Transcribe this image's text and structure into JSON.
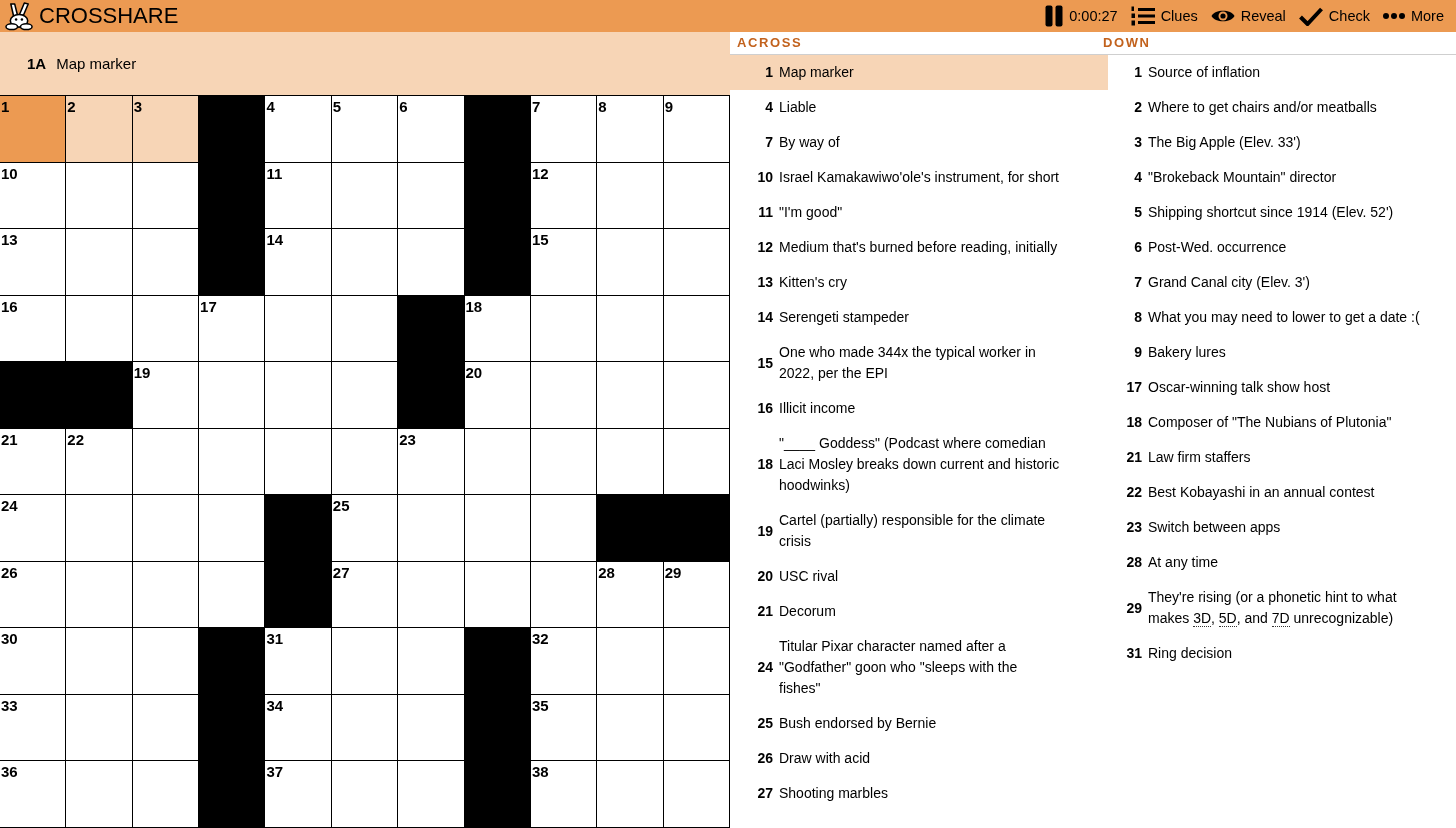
{
  "app": {
    "name": "CROSSHARE"
  },
  "toolbar": [
    {
      "kind": "timer",
      "label": "0:00:27"
    },
    {
      "kind": "clues",
      "label": "Clues"
    },
    {
      "kind": "reveal",
      "label": "Reveal"
    },
    {
      "kind": "check",
      "label": "Check"
    },
    {
      "kind": "more",
      "label": "More"
    }
  ],
  "current_clue": {
    "label": "1A",
    "text": "Map marker"
  },
  "grid": {
    "rows": [
      [
        {
          "kind": "open",
          "number": "1",
          "selected": true
        },
        {
          "kind": "open",
          "number": "2",
          "selected": false,
          "in_word": true
        },
        {
          "kind": "open",
          "number": "3",
          "selected": false,
          "in_word": true
        },
        {
          "kind": "block"
        },
        {
          "kind": "open",
          "number": "4",
          "selected": false,
          "in_word": false
        },
        {
          "kind": "open",
          "number": "5",
          "selected": false,
          "in_word": false
        },
        {
          "kind": "open",
          "number": "6",
          "selected": false,
          "in_word": false
        },
        {
          "kind": "block"
        },
        {
          "kind": "open",
          "number": "7",
          "selected": false,
          "in_word": false
        },
        {
          "kind": "open",
          "number": "8",
          "selected": false,
          "in_word": false
        },
        {
          "kind": "open",
          "number": "9",
          "selected": false,
          "in_word": false
        }
      ],
      [
        {
          "kind": "open",
          "number": "10",
          "selected": false,
          "in_word": false
        },
        {
          "kind": "open",
          "selected": false,
          "in_word": false
        },
        {
          "kind": "open",
          "selected": false,
          "in_word": false
        },
        {
          "kind": "block"
        },
        {
          "kind": "open",
          "number": "11",
          "selected": false,
          "in_word": false
        },
        {
          "kind": "open",
          "selected": false,
          "in_word": false
        },
        {
          "kind": "open",
          "selected": false,
          "in_word": false
        },
        {
          "kind": "block"
        },
        {
          "kind": "open",
          "number": "12",
          "selected": false,
          "in_word": false
        },
        {
          "kind": "open",
          "selected": false,
          "in_word": false
        },
        {
          "kind": "open",
          "selected": false,
          "in_word": false
        }
      ],
      [
        {
          "kind": "open",
          "number": "13",
          "selected": false,
          "in_word": false
        },
        {
          "kind": "open",
          "selected": false,
          "in_word": false
        },
        {
          "kind": "open",
          "selected": false,
          "in_word": false
        },
        {
          "kind": "block"
        },
        {
          "kind": "open",
          "number": "14",
          "selected": false,
          "in_word": false
        },
        {
          "kind": "open",
          "selected": false,
          "in_word": false
        },
        {
          "kind": "open",
          "selected": false,
          "in_word": false
        },
        {
          "kind": "block"
        },
        {
          "kind": "open",
          "number": "15",
          "selected": false,
          "in_word": false
        },
        {
          "kind": "open",
          "selected": false,
          "in_word": false
        },
        {
          "kind": "open",
          "selected": false,
          "in_word": false
        }
      ],
      [
        {
          "kind": "open",
          "number": "16",
          "selected": false,
          "in_word": false
        },
        {
          "kind": "open",
          "selected": false,
          "in_word": false
        },
        {
          "kind": "open",
          "selected": false,
          "in_word": false
        },
        {
          "kind": "open",
          "number": "17",
          "selected": false,
          "in_word": false
        },
        {
          "kind": "open",
          "selected": false,
          "in_word": false
        },
        {
          "kind": "open",
          "selected": false,
          "in_word": false
        },
        {
          "kind": "block"
        },
        {
          "kind": "open",
          "number": "18",
          "selected": false,
          "in_word": false
        },
        {
          "kind": "open",
          "selected": false,
          "in_word": false
        },
        {
          "kind": "open",
          "selected": false,
          "in_word": false
        },
        {
          "kind": "open",
          "selected": false,
          "in_word": false
        }
      ],
      [
        {
          "kind": "block"
        },
        {
          "kind": "block"
        },
        {
          "kind": "open",
          "number": "19",
          "selected": false,
          "in_word": false
        },
        {
          "kind": "open",
          "selected": false,
          "in_word": false
        },
        {
          "kind": "open",
          "selected": false,
          "in_word": false
        },
        {
          "kind": "open",
          "selected": false,
          "in_word": false
        },
        {
          "kind": "block"
        },
        {
          "kind": "open",
          "number": "20",
          "selected": false,
          "in_word": false
        },
        {
          "kind": "open",
          "selected": false,
          "in_word": false
        },
        {
          "kind": "open",
          "selected": false,
          "in_word": false
        },
        {
          "kind": "open",
          "selected": false,
          "in_word": false
        }
      ],
      [
        {
          "kind": "open",
          "number": "21",
          "selected": false,
          "in_word": false
        },
        {
          "kind": "open",
          "number": "22",
          "selected": false,
          "in_word": false
        },
        {
          "kind": "open",
          "selected": false,
          "in_word": false
        },
        {
          "kind": "open",
          "selected": false,
          "in_word": false
        },
        {
          "kind": "open",
          "selected": false,
          "in_word": false
        },
        {
          "kind": "open",
          "selected": false,
          "in_word": false
        },
        {
          "kind": "open",
          "number": "23",
          "selected": false,
          "in_word": false
        },
        {
          "kind": "open",
          "selected": false,
          "in_word": false
        },
        {
          "kind": "open",
          "selected": false,
          "in_word": false
        },
        {
          "kind": "open",
          "selected": false,
          "in_word": false
        },
        {
          "kind": "open",
          "selected": false,
          "in_word": false
        }
      ],
      [
        {
          "kind": "open",
          "number": "24",
          "selected": false,
          "in_word": false
        },
        {
          "kind": "open",
          "selected": false,
          "in_word": false
        },
        {
          "kind": "open",
          "selected": false,
          "in_word": false
        },
        {
          "kind": "open",
          "selected": false,
          "in_word": false
        },
        {
          "kind": "block"
        },
        {
          "kind": "open",
          "number": "25",
          "selected": false,
          "in_word": false
        },
        {
          "kind": "open",
          "selected": false,
          "in_word": false
        },
        {
          "kind": "open",
          "selected": false,
          "in_word": false
        },
        {
          "kind": "open",
          "selected": false,
          "in_word": false
        },
        {
          "kind": "block"
        },
        {
          "kind": "block"
        }
      ],
      [
        {
          "kind": "open",
          "number": "26",
          "selected": false,
          "in_word": false
        },
        {
          "kind": "open",
          "selected": false,
          "in_word": false
        },
        {
          "kind": "open",
          "selected": false,
          "in_word": false
        },
        {
          "kind": "open",
          "selected": false,
          "in_word": false
        },
        {
          "kind": "block"
        },
        {
          "kind": "open",
          "number": "27",
          "selected": false,
          "in_word": false
        },
        {
          "kind": "open",
          "selected": false,
          "in_word": false
        },
        {
          "kind": "open",
          "selected": false,
          "in_word": false
        },
        {
          "kind": "open",
          "selected": false,
          "in_word": false
        },
        {
          "kind": "open",
          "number": "28",
          "selected": false,
          "in_word": false
        },
        {
          "kind": "open",
          "number": "29",
          "selected": false,
          "in_word": false
        }
      ],
      [
        {
          "kind": "open",
          "number": "30",
          "selected": false,
          "in_word": false
        },
        {
          "kind": "open",
          "selected": false,
          "in_word": false
        },
        {
          "kind": "open",
          "selected": false,
          "in_word": false
        },
        {
          "kind": "block"
        },
        {
          "kind": "open",
          "number": "31",
          "selected": false,
          "in_word": false
        },
        {
          "kind": "open",
          "selected": false,
          "in_word": false
        },
        {
          "kind": "open",
          "selected": false,
          "in_word": false
        },
        {
          "kind": "block"
        },
        {
          "kind": "open",
          "number": "32",
          "selected": false,
          "in_word": false
        },
        {
          "kind": "open",
          "selected": false,
          "in_word": false
        },
        {
          "kind": "open",
          "selected": false,
          "in_word": false
        }
      ],
      [
        {
          "kind": "open",
          "number": "33",
          "selected": false,
          "in_word": false
        },
        {
          "kind": "open",
          "selected": false,
          "in_word": false
        },
        {
          "kind": "open",
          "selected": false,
          "in_word": false
        },
        {
          "kind": "block"
        },
        {
          "kind": "open",
          "number": "34",
          "selected": false,
          "in_word": false
        },
        {
          "kind": "open",
          "selected": false,
          "in_word": false
        },
        {
          "kind": "open",
          "selected": false,
          "in_word": false
        },
        {
          "kind": "block"
        },
        {
          "kind": "open",
          "number": "35",
          "selected": false,
          "in_word": false
        },
        {
          "kind": "open",
          "selected": false,
          "in_word": false
        },
        {
          "kind": "open",
          "selected": false,
          "in_word": false
        }
      ],
      [
        {
          "kind": "open",
          "number": "36",
          "selected": false,
          "in_word": false
        },
        {
          "kind": "open",
          "selected": false,
          "in_word": false
        },
        {
          "kind": "open",
          "selected": false,
          "in_word": false
        },
        {
          "kind": "block"
        },
        {
          "kind": "open",
          "number": "37",
          "selected": false,
          "in_word": false
        },
        {
          "kind": "open",
          "selected": false,
          "in_word": false
        },
        {
          "kind": "open",
          "selected": false,
          "in_word": false
        },
        {
          "kind": "block"
        },
        {
          "kind": "open",
          "number": "38",
          "selected": false,
          "in_word": false
        },
        {
          "kind": "open",
          "selected": false,
          "in_word": false
        },
        {
          "kind": "open",
          "selected": false,
          "in_word": false
        }
      ]
    ]
  },
  "clue_lists": [
    {
      "title": "ACROSS",
      "clues": [
        {
          "number": "1",
          "text": "Map marker",
          "selected": true
        },
        {
          "number": "4",
          "text": "Liable",
          "selected": false
        },
        {
          "number": "7",
          "text": "By way of",
          "selected": false
        },
        {
          "number": "10",
          "text": "Israel Kamakawiwo'ole's instrument, for short",
          "selected": false
        },
        {
          "number": "11",
          "text": "\"I'm good\"",
          "selected": false
        },
        {
          "number": "12",
          "text": "Medium that's burned before reading, initially",
          "selected": false
        },
        {
          "number": "13",
          "text": "Kitten's cry",
          "selected": false
        },
        {
          "number": "14",
          "text": "Serengeti stampeder",
          "selected": false
        },
        {
          "number": "15",
          "text": "One who made 344x the typical worker in 2022, per the EPI",
          "selected": false
        },
        {
          "number": "16",
          "text": "Illicit income",
          "selected": false
        },
        {
          "number": "18",
          "text": "\"____ Goddess\" (Podcast where comedian Laci Mosley breaks down current and historic hoodwinks)",
          "selected": false
        },
        {
          "number": "19",
          "text": "Cartel (partially) responsible for the climate crisis",
          "selected": false
        },
        {
          "number": "20",
          "text": "USC rival",
          "selected": false
        },
        {
          "number": "21",
          "text": "Decorum",
          "selected": false
        },
        {
          "number": "24",
          "text": "Titular Pixar character named after a \"Godfather\" goon who \"sleeps with the fishes\"",
          "selected": false
        },
        {
          "number": "25",
          "text": "Bush endorsed by Bernie",
          "selected": false
        },
        {
          "number": "26",
          "text": "Draw with acid",
          "selected": false
        },
        {
          "number": "27",
          "text": "Shooting marbles",
          "selected": false
        }
      ]
    },
    {
      "title": "DOWN",
      "clues": [
        {
          "number": "1",
          "text": "Source of inflation",
          "selected": false
        },
        {
          "number": "2",
          "text": "Where to get chairs and/or meatballs",
          "selected": false
        },
        {
          "number": "3",
          "text": "The Big Apple (Elev. 33')",
          "selected": false
        },
        {
          "number": "4",
          "text": "\"Brokeback Mountain\" director",
          "selected": false
        },
        {
          "number": "5",
          "text": "Shipping shortcut since 1914 (Elev. 52')",
          "selected": false
        },
        {
          "number": "6",
          "text": "Post-Wed. occurrence",
          "selected": false
        },
        {
          "number": "7",
          "text": "Grand Canal city (Elev. 3')",
          "selected": false
        },
        {
          "number": "8",
          "text": "What you may need to lower to get a date :(",
          "selected": false
        },
        {
          "number": "9",
          "text": "Bakery lures",
          "selected": false
        },
        {
          "number": "17",
          "text": "Oscar-winning talk show host",
          "selected": false
        },
        {
          "number": "18",
          "text": "Composer of \"The Nubians of Plutonia\"",
          "selected": false
        },
        {
          "number": "21",
          "text": "Law firm staffers",
          "selected": false
        },
        {
          "number": "22",
          "text": "Best Kobayashi in an annual contest",
          "selected": false
        },
        {
          "number": "23",
          "text": "Switch between apps",
          "selected": false
        },
        {
          "number": "28",
          "text": "At any time",
          "selected": false
        },
        {
          "number": "29",
          "segments": [
            {
              "kind": "plain",
              "text": "They're rising (or a phonetic hint to what makes "
            },
            {
              "kind": "ref",
              "text": "3D"
            },
            {
              "kind": "plain",
              "text": ", "
            },
            {
              "kind": "ref",
              "text": "5D"
            },
            {
              "kind": "plain",
              "text": ", and "
            },
            {
              "kind": "ref",
              "text": "7D"
            },
            {
              "kind": "plain",
              "text": " unrecognizable)"
            }
          ],
          "selected": false
        },
        {
          "number": "31",
          "text": "Ring decision",
          "selected": false
        }
      ]
    }
  ]
}
